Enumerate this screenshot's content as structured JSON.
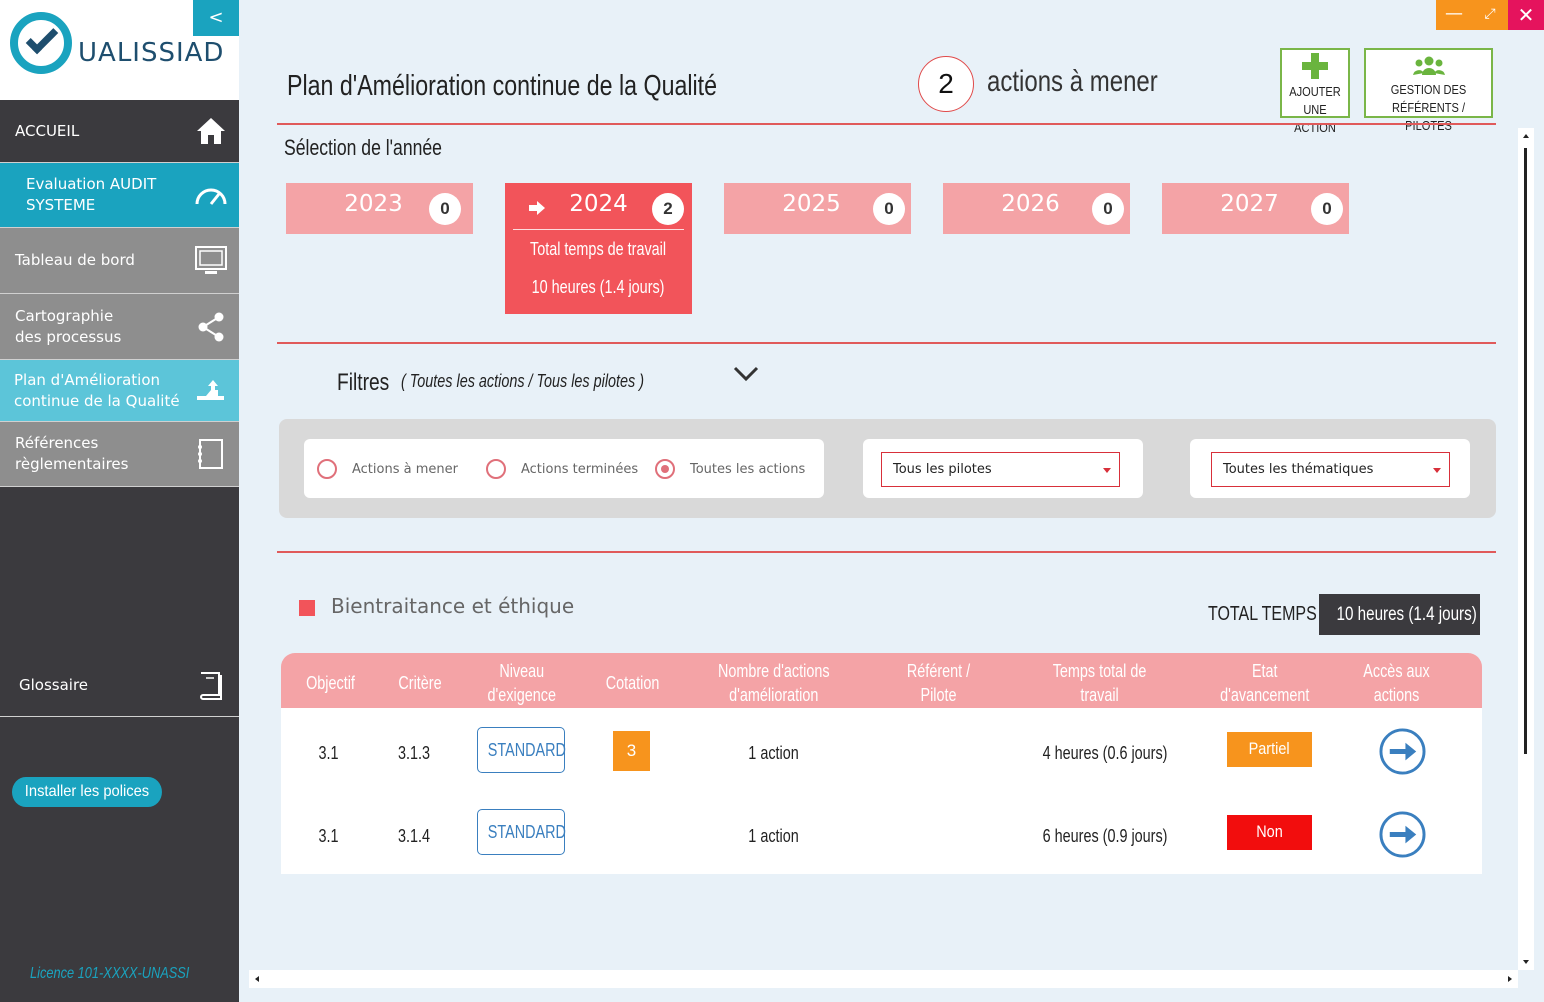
{
  "logo": {
    "text": "UALISSIAD"
  },
  "sidebar": {
    "collapse_label": "<",
    "items": [
      {
        "label": "ACCUEIL"
      },
      {
        "label": "Evaluation AUDIT\nSYSTEME"
      },
      {
        "label": "Tableau de bord"
      },
      {
        "label": "Cartographie\ndes processus"
      },
      {
        "label": "Plan d'Amélioration\ncontinue de la Qualité"
      },
      {
        "label": "Références\nrèglementaires"
      },
      {
        "label": "Glossaire"
      }
    ],
    "install_label": "Installer les polices",
    "licence": "Licence 101-XXXX-UNASSI"
  },
  "window": {
    "minimize": "—",
    "maximize": "⤢",
    "close": "✕"
  },
  "header": {
    "title": "Plan d'Amélioration continue de la Qualité",
    "actions_count": "2",
    "actions_label": "actions à mener",
    "add_action_line1": "AJOUTER UNE",
    "add_action_line2": "ACTION",
    "referents_line1": "GESTION DES",
    "referents_line2": "RÉFÉRENTS / PILOTES"
  },
  "year_section": {
    "label": "Sélection de l'année",
    "years": [
      {
        "year": "2023",
        "count": "0"
      },
      {
        "year": "2024",
        "count": "2"
      },
      {
        "year": "2025",
        "count": "0"
      },
      {
        "year": "2026",
        "count": "0"
      },
      {
        "year": "2027",
        "count": "0"
      }
    ],
    "active_total_label": "Total temps de travail",
    "active_total_value": "10 heures (1.4 jours)"
  },
  "filters": {
    "title": "Filtres",
    "summary": "( Toutes les actions / Tous les pilotes )",
    "radios": [
      {
        "label": "Actions à mener",
        "selected": false
      },
      {
        "label": "Actions terminées",
        "selected": false
      },
      {
        "label": "Toutes les actions",
        "selected": true
      }
    ],
    "pilot_select": "Tous les pilotes",
    "theme_select": "Toutes les thématiques"
  },
  "theme": {
    "name": "Bientraitance et éthique",
    "color": "#f2545a",
    "total_label": "TOTAL TEMPS",
    "total_value": "10 heures (1.4 jours)"
  },
  "table": {
    "headers": [
      "Objectif",
      "Critère",
      "Niveau\nd'exigence",
      "Cotation",
      "Nombre d'actions\nd'amélioration",
      "Référent /\nPilote",
      "Temps total de\ntravail",
      "Etat\nd'avancement",
      "Accès aux\nactions"
    ],
    "rows": [
      {
        "objectif": "3.1",
        "critere": "3.1.3",
        "niveau": "STANDARD",
        "cotation": "3",
        "nb_actions": "1 action",
        "referent": "",
        "temps": "4 heures (0.6 jours)",
        "etat": "Partiel",
        "etat_color": "#f7941d"
      },
      {
        "objectif": "3.1",
        "critere": "3.1.4",
        "niveau": "STANDARD",
        "cotation": "",
        "nb_actions": "1 action",
        "referent": "",
        "temps": "6 heures (0.9 jours)",
        "etat": "Non débuté",
        "etat_color": "#f20d0d"
      }
    ]
  },
  "colors": {
    "accent": "#1aa3bf",
    "red": "#f2545a",
    "pink": "#f4a3a6",
    "orange": "#f7941d",
    "dark": "#3b3a3e"
  }
}
